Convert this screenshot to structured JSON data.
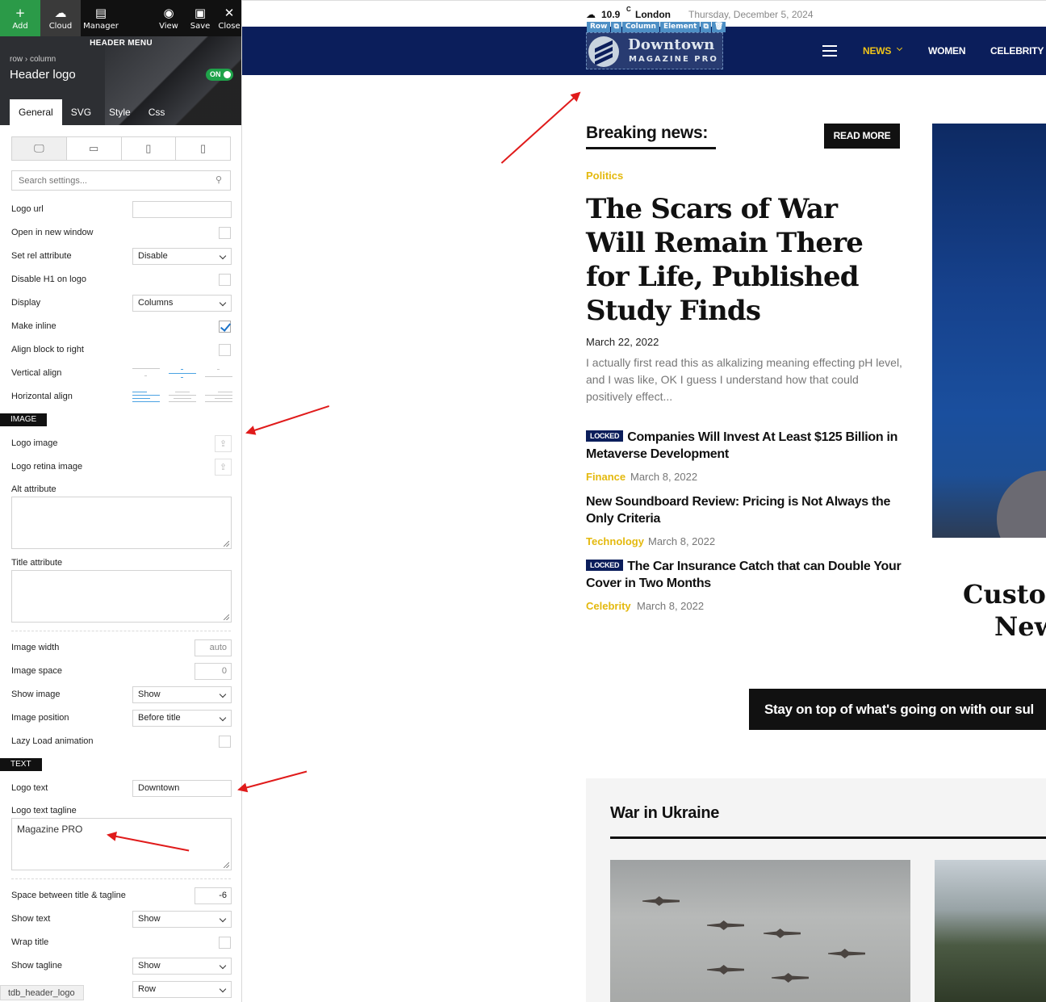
{
  "toolbar": {
    "add": "Add",
    "cloud": "Cloud",
    "manager": "Manager",
    "view": "View",
    "save": "Save",
    "close": "Close"
  },
  "panel": {
    "title": "HEADER MENU",
    "breadcrumb": "row › column",
    "element_name": "Header logo",
    "toggle": "ON",
    "tabs": [
      "General",
      "SVG",
      "Style",
      "Css"
    ],
    "search_placeholder": "Search settings...",
    "fields": {
      "logo_url": {
        "label": "Logo url",
        "value": ""
      },
      "open_new_window": {
        "label": "Open in new window"
      },
      "rel_attribute": {
        "label": "Set rel attribute",
        "value": "Disable"
      },
      "disable_h1": {
        "label": "Disable H1 on logo"
      },
      "display": {
        "label": "Display",
        "value": "Columns"
      },
      "make_inline": {
        "label": "Make inline",
        "checked": true
      },
      "align_right": {
        "label": "Align block to right"
      },
      "vertical_align": {
        "label": "Vertical align"
      },
      "horizontal_align": {
        "label": "Horizontal align"
      },
      "logo_image": {
        "label": "Logo image"
      },
      "logo_retina": {
        "label": "Logo retina image"
      },
      "alt_attribute": {
        "label": "Alt attribute"
      },
      "title_attribute": {
        "label": "Title attribute"
      },
      "image_width": {
        "label": "Image width",
        "value": "auto"
      },
      "image_space": {
        "label": "Image space",
        "value": "0"
      },
      "show_image": {
        "label": "Show image",
        "value": "Show"
      },
      "image_position": {
        "label": "Image position",
        "value": "Before title"
      },
      "lazy_load": {
        "label": "Lazy Load animation"
      },
      "logo_text": {
        "label": "Logo text",
        "value": "Downtown"
      },
      "logo_tagline": {
        "label": "Logo text tagline",
        "value": "Magazine PRO"
      },
      "space_title_tagline": {
        "label": "Space between title & tagline",
        "value": "-6"
      },
      "show_text": {
        "label": "Show text",
        "value": "Show"
      },
      "wrap_title": {
        "label": "Wrap title"
      },
      "show_tagline": {
        "label": "Show tagline",
        "value": "Show"
      },
      "last_select": {
        "value": "Row"
      }
    },
    "sections": {
      "image": "IMAGE",
      "text": "TEXT"
    },
    "footer_tag": "tdb_header_logo"
  },
  "site": {
    "topbar": {
      "temp": "10.9",
      "deg": "C",
      "city": "London",
      "date": "Thursday, December 5, 2024"
    },
    "edit_tabs": [
      "Row",
      "Column",
      "Element"
    ],
    "logo": {
      "title": "Downtown",
      "tagline": "MAGAZINE PRO"
    },
    "nav": [
      "NEWS",
      "WOMEN",
      "CELEBRITY"
    ],
    "breaking_title": "Breaking news:",
    "read_more": "READ MORE",
    "main": {
      "category": "Politics",
      "title": "The Scars of War Will Remain There for Life, Published Study Finds",
      "date": "March 22, 2022",
      "excerpt": "I actually first read this as alkalizing meaning effecting pH level, and I was like, OK I guess I understand how that could positively effect..."
    },
    "locked_label": "LOCKED",
    "stories": [
      {
        "title": "Companies Will Invest At Least $125 Billion in Metaverse Development",
        "category": "Finance",
        "date": "March 8, 2022"
      },
      {
        "title": "New Soundboard Review: Pricing is Not Always the Only Criteria",
        "category": "Technology",
        "date": "March 8, 2022"
      },
      {
        "title": "The Car Insurance Catch that can Double Your Cover in Two Months",
        "category": "Celebrity",
        "date": "March 8, 2022"
      }
    ],
    "cut_heading": [
      "Custor",
      "New"
    ],
    "banner": "Stay on top of what's going on with our sul",
    "section_title": "War in Ukraine"
  },
  "colors": {
    "accent_yellow": "#e4b90e",
    "navy": "#0b1e5b",
    "add_green": "#2b9a48",
    "arrow_red": "#e01b1b"
  }
}
